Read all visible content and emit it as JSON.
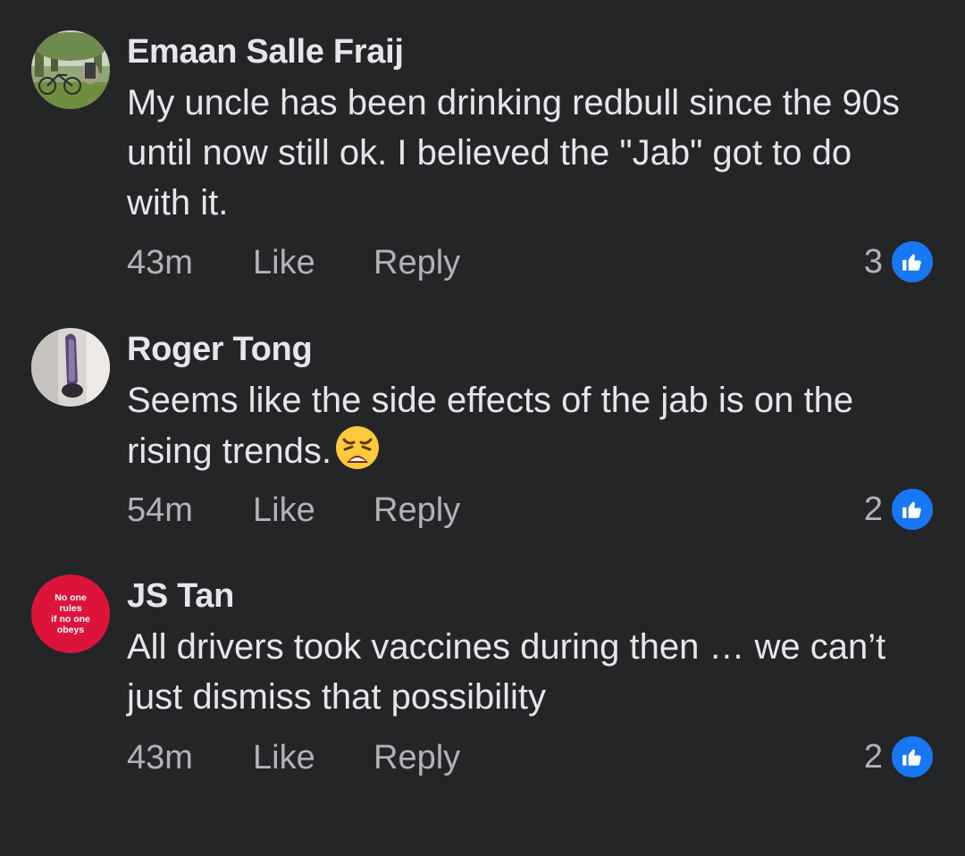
{
  "comments": [
    {
      "author": "Emaan Salle Fraij",
      "text": "My uncle has been drinking redbull since the 90s until now still ok. I believed the \"Jab\" got to do with it.",
      "time": "43m",
      "like_label": "Like",
      "reply_label": "Reply",
      "reaction_count": "3",
      "reaction_icon": "thumbs-up-icon"
    },
    {
      "author": "Roger Tong",
      "text": "Seems like the side effects of the jab is on the rising trends.",
      "emoji": "weary-face-emoji",
      "time": "54m",
      "like_label": "Like",
      "reply_label": "Reply",
      "reaction_count": "2",
      "reaction_icon": "thumbs-up-icon"
    },
    {
      "author": "JS Tan",
      "text": "All drivers took vaccines during then … we can’t just dismiss that possibility",
      "avatar_text": [
        "No one",
        "rules",
        "if no one",
        "obeys"
      ],
      "time": "43m",
      "like_label": "Like",
      "reply_label": "Reply",
      "reaction_count": "2",
      "reaction_icon": "thumbs-up-icon"
    }
  ],
  "colors": {
    "background": "#242526",
    "primary_text": "#e4e6eb",
    "secondary_text": "#b0b3b8",
    "like_blue": "#1877f2",
    "avatar_red": "#dc143c"
  }
}
